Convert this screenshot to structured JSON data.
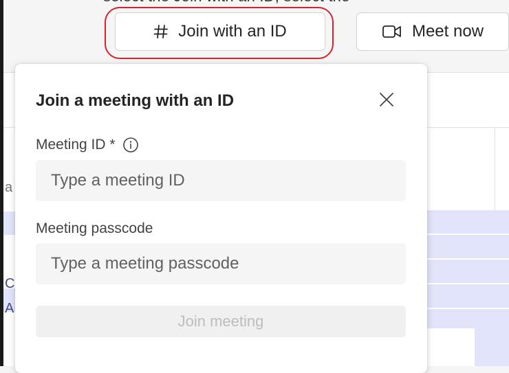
{
  "page": {
    "top_caption": "select the Join with an ID, select the"
  },
  "toolbar": {
    "join_with_id_label": "Join with an ID",
    "meet_now_label": "Meet now"
  },
  "join_dialog": {
    "title": "Join a meeting with an ID",
    "meeting_id_label": "Meeting ID *",
    "meeting_id_placeholder": "Type a meeting ID",
    "meeting_id_value": "",
    "passcode_label": "Meeting passcode",
    "passcode_placeholder": "Type a meeting passcode",
    "passcode_value": "",
    "join_button_label": "Join meeting",
    "join_button_enabled": false
  },
  "background": {
    "left_glyphs": [
      "a",
      "C",
      "A"
    ]
  },
  "icons": {
    "join_with_id": "hash-icon",
    "meet_now": "video-camera-icon",
    "close": "close-icon",
    "meeting_id_info": "info-icon"
  },
  "colors": {
    "highlight_ring": "#d6232f",
    "calendar_band": "#e2e4fb",
    "input_background": "#f5f5f5",
    "disabled_text": "#bdbdbd"
  }
}
